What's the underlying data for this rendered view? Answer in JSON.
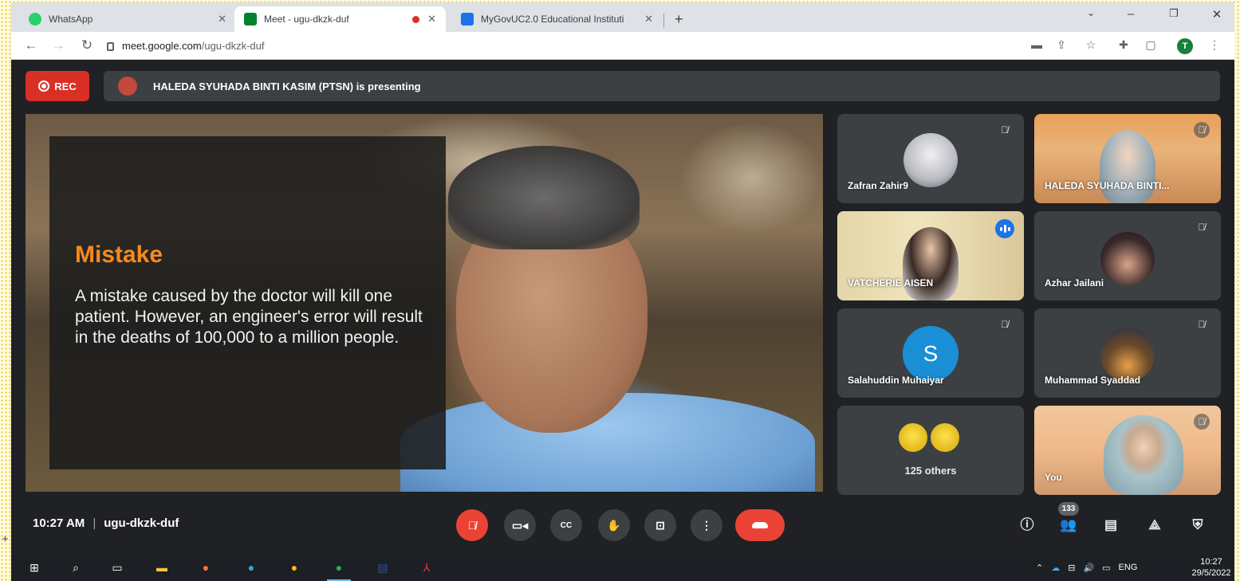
{
  "browser": {
    "tabs": [
      {
        "title": "WhatsApp",
        "favicon_color": "#25d366",
        "active": false
      },
      {
        "title": "Meet - ugu-dkzk-duf",
        "favicon_color": "#00832d",
        "active": true,
        "recording": true
      },
      {
        "title": "MyGovUC2.0 Educational Instituti",
        "favicon_color": "#1a73e8",
        "active": false
      }
    ],
    "url_host": "meet.google.com",
    "url_path": "/ugu-dkzk-duf",
    "profile_initial": "T",
    "icons": [
      "minimize-icon",
      "maximize-icon",
      "close-icon",
      "back-icon",
      "forward-icon",
      "reload-icon",
      "cast-icon",
      "share-icon",
      "star-icon",
      "extensions-icon",
      "sidepanel-icon",
      "menu-icon"
    ]
  },
  "meet": {
    "rec_label": "REC",
    "presenting_text": "HALEDA SYUHADA BINTI KASIM (PTSN) is presenting",
    "slide": {
      "title": "Mistake",
      "body": "A mistake caused by the doctor will kill one patient. However, an engineer's error will result in the deaths of 100,000 to a million people.",
      "title_color": "#f58a1f"
    },
    "participants": [
      {
        "name": "Zafran Zahir9",
        "muted": true
      },
      {
        "name": "HALEDA SYUHADA BINTI...",
        "muted": true
      },
      {
        "name": "VATCHERIE AISEN",
        "muted": false,
        "speaking": true
      },
      {
        "name": "Azhar Jailani",
        "muted": true
      },
      {
        "name": "Salahuddin Muhaiyar",
        "initial": "S",
        "muted": true
      },
      {
        "name": "Muhammad Syaddad",
        "muted": true
      },
      {
        "name": "125 others"
      },
      {
        "name": "You",
        "muted": true
      }
    ],
    "time": "10:27 AM",
    "meeting_code": "ugu-dkzk-duf",
    "people_count": "133",
    "accent_red": "#ea4335",
    "accent_blue": "#1a73e8"
  },
  "taskbar": {
    "language": "ENG",
    "time": "10:27",
    "date": "29/5/2022"
  }
}
